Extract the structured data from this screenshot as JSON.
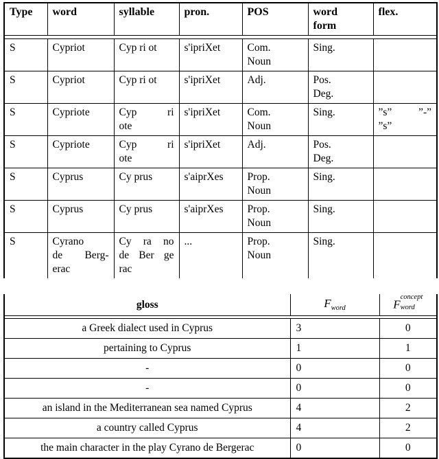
{
  "morphology_table": {
    "columns": [
      "Type",
      "word",
      "syllable",
      "pron.",
      "POS",
      "word form",
      "flex."
    ],
    "headers": {
      "type": "Type",
      "word": "word",
      "syllable": "syllable",
      "pron": "pron.",
      "pos": "POS",
      "word_form_line1": "word",
      "word_form_line2": "form",
      "flex": "flex."
    },
    "rows": [
      {
        "type": "S",
        "word": [
          "Cypriot"
        ],
        "syllable": [
          "Cyp ri ot"
        ],
        "pron": "s'ipriXet",
        "pos": [
          "Com.",
          "Noun"
        ],
        "word_form": [
          "Sing."
        ],
        "flex": []
      },
      {
        "type": "S",
        "word": [
          "Cypriot"
        ],
        "syllable": [
          "Cyp ri ot"
        ],
        "pron": "s'ipriXet",
        "pos": [
          "Adj."
        ],
        "word_form": [
          "Pos.",
          "Deg."
        ],
        "flex": []
      },
      {
        "type": "S",
        "word": [
          "Cypriote"
        ],
        "syllable": [
          "Cyp ri",
          "ote"
        ],
        "pron": "s'ipriXet",
        "pos": [
          "Com.",
          "Noun"
        ],
        "word_form": [
          "Sing."
        ],
        "flex": [
          "”s” ”-”",
          "”s”"
        ]
      },
      {
        "type": "S",
        "word": [
          "Cypriote"
        ],
        "syllable": [
          "Cyp ri",
          "ote"
        ],
        "pron": "s'ipriXet",
        "pos": [
          "Adj."
        ],
        "word_form": [
          "Pos.",
          "Deg."
        ],
        "flex": []
      },
      {
        "type": "S",
        "word": [
          "Cyprus"
        ],
        "syllable": [
          "Cy prus"
        ],
        "pron": "s'aiprXes",
        "pos": [
          "Prop.",
          "Noun"
        ],
        "word_form": [
          "Sing."
        ],
        "flex": []
      },
      {
        "type": "S",
        "word": [
          "Cyprus"
        ],
        "syllable": [
          "Cy prus"
        ],
        "pron": "s'aiprXes",
        "pos": [
          "Prop.",
          "Noun"
        ],
        "word_form": [
          "Sing."
        ],
        "flex": []
      },
      {
        "type": "S",
        "word": [
          "Cyrano",
          "de Berg-",
          "erac"
        ],
        "syllable": [
          "Cy ra no",
          "de Ber ge",
          "rac"
        ],
        "pron": "...",
        "pos": [
          "Prop.",
          "Noun"
        ],
        "word_form": [
          "Sing."
        ],
        "flex": []
      }
    ]
  },
  "gloss_table": {
    "headers": {
      "gloss": "gloss",
      "f_word_base": "F",
      "f_word_sub": "word",
      "f_concept_base": "F",
      "f_concept_sup": "concept",
      "f_concept_sub": "word"
    },
    "rows": [
      {
        "gloss": "a Greek dialect used in Cyprus",
        "f_word": "3",
        "f_concept_word": "0"
      },
      {
        "gloss": "pertaining to Cyprus",
        "f_word": "1",
        "f_concept_word": "1"
      },
      {
        "gloss": "-",
        "f_word": "0",
        "f_concept_word": "0"
      },
      {
        "gloss": "-",
        "f_word": "0",
        "f_concept_word": "0"
      },
      {
        "gloss": "an island in the Mediterranean sea named Cyprus",
        "f_word": "4",
        "f_concept_word": "2"
      },
      {
        "gloss": "a country called Cyprus",
        "f_word": "4",
        "f_concept_word": "2"
      },
      {
        "gloss": "the main character in the play Cyrano de Bergerac",
        "f_word": "0",
        "f_concept_word": "0"
      }
    ]
  }
}
